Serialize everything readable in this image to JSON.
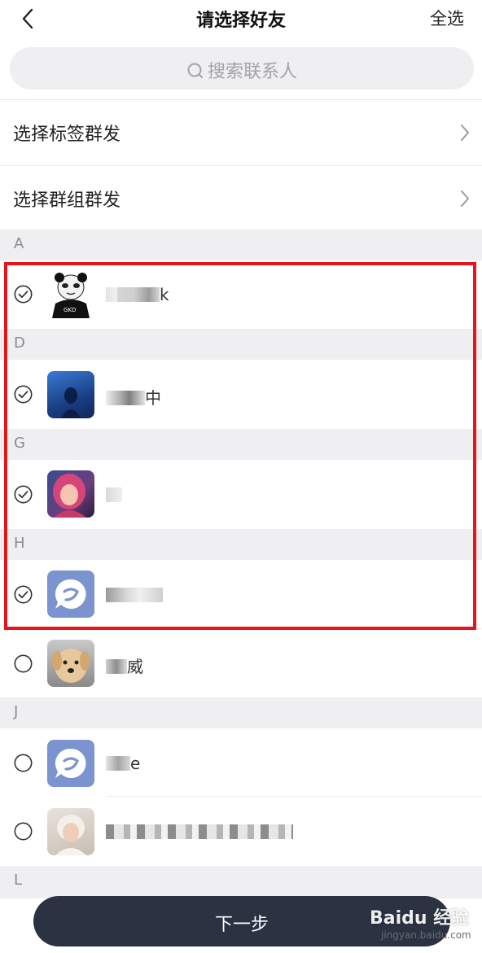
{
  "header": {
    "title": "请选择好友",
    "select_all": "全选"
  },
  "search": {
    "placeholder": "搜索联系人"
  },
  "menus": [
    {
      "label": "选择标签群发"
    },
    {
      "label": "选择群组群发"
    }
  ],
  "sections": [
    {
      "letter": "A"
    },
    {
      "letter": "D"
    },
    {
      "letter": "G"
    },
    {
      "letter": "H"
    },
    {
      "letter": "J"
    },
    {
      "letter": "L"
    }
  ],
  "contacts": [
    {
      "name_visible": "k",
      "avatar": "panda-meme-avatar",
      "checked": true
    },
    {
      "name_visible": "中",
      "avatar": "blue-photo-avatar",
      "checked": true
    },
    {
      "name_visible": "",
      "avatar": "pink-hair-girl-avatar",
      "checked": true
    },
    {
      "name_visible": "",
      "avatar": "chat-app-logo-avatar",
      "checked": true
    },
    {
      "name_visible": "威",
      "avatar": "puppy-avatar",
      "checked": false
    },
    {
      "name_visible": "e",
      "avatar": "chat-app-logo-avatar",
      "checked": false
    },
    {
      "name_visible": "",
      "avatar": "girl-portrait-avatar",
      "checked": false
    }
  ],
  "avatar_text": {
    "panda_shirt": "GKD"
  },
  "footer": {
    "next_label": "下一步"
  },
  "watermark": {
    "brand": "Baidu 经验",
    "url": "jingyan.baidu.com"
  },
  "colors": {
    "highlight_box": "#e8141b",
    "next_button": "#2b3242",
    "section_bg": "#efeff1",
    "logo_blue": "#7b93cf"
  }
}
